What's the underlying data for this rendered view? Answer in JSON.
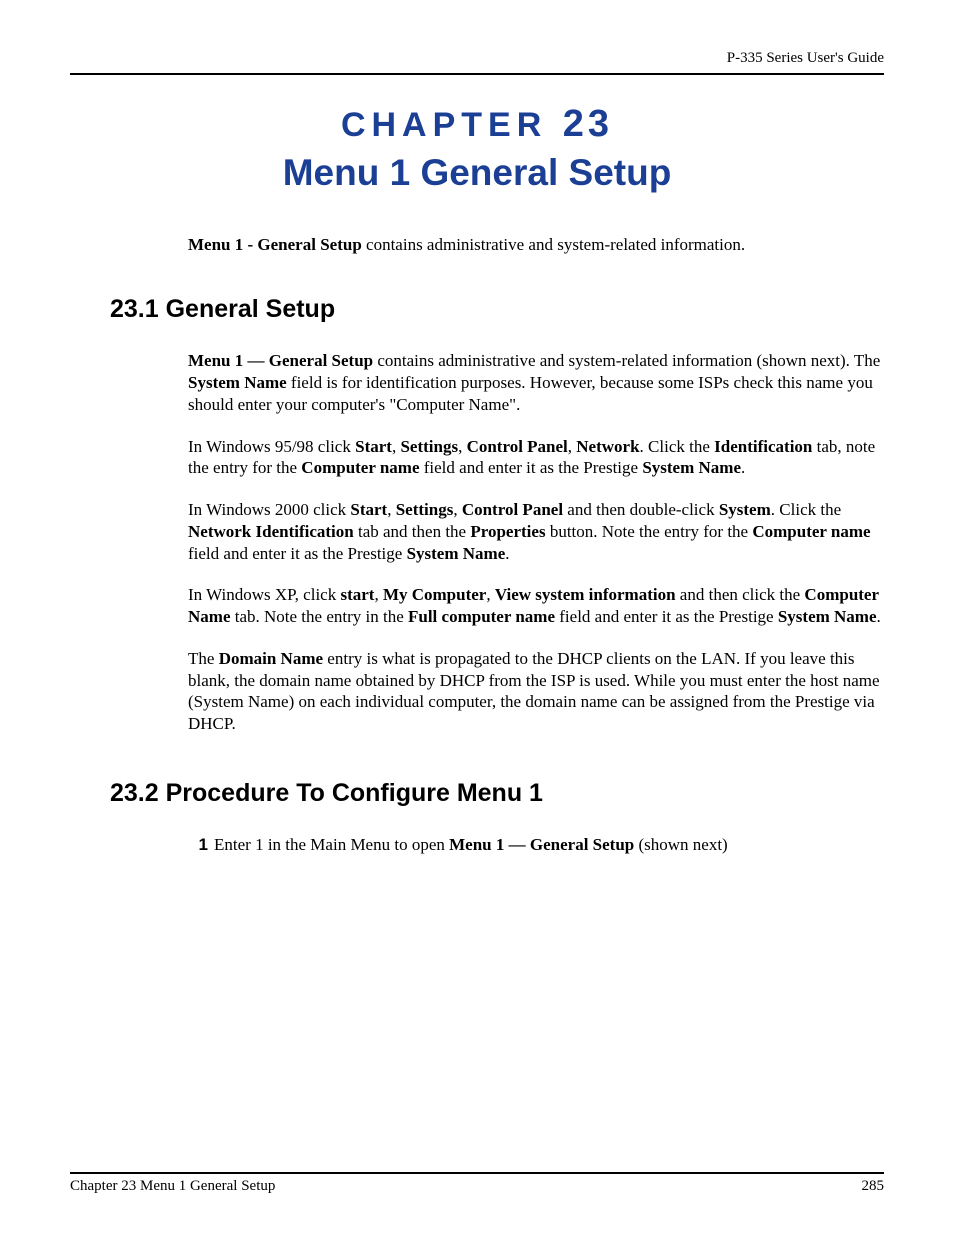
{
  "header": {
    "running": "P-335 Series User's Guide"
  },
  "chapter": {
    "label_word": "CHAPTER",
    "label_num": "23",
    "title": "Menu 1 General Setup"
  },
  "intro": {
    "bold": "Menu 1 - General Setup",
    "rest": " contains administrative and system-related information."
  },
  "section1": {
    "heading": "23.1  General Setup",
    "p1": {
      "runs": [
        {
          "b": true,
          "t": "Menu 1 — General Setup"
        },
        {
          "b": false,
          "t": " contains administrative and system-related information (shown next). The "
        },
        {
          "b": true,
          "t": "System Name"
        },
        {
          "b": false,
          "t": " field is for identification purposes. However, because some ISPs check this name you should enter your computer's  \"Computer Name\"."
        }
      ]
    },
    "p2": {
      "runs": [
        {
          "b": false,
          "t": "In Windows 95/98 click "
        },
        {
          "b": true,
          "t": "Start"
        },
        {
          "b": false,
          "t": ", "
        },
        {
          "b": true,
          "t": "Settings"
        },
        {
          "b": false,
          "t": ", "
        },
        {
          "b": true,
          "t": "Control Panel"
        },
        {
          "b": false,
          "t": ", "
        },
        {
          "b": true,
          "t": "Network"
        },
        {
          "b": false,
          "t": ". Click the "
        },
        {
          "b": true,
          "t": "Identification"
        },
        {
          "b": false,
          "t": " tab, note the entry for the "
        },
        {
          "b": true,
          "t": "Computer name"
        },
        {
          "b": false,
          "t": " field and enter it as the Prestige "
        },
        {
          "b": true,
          "t": "System Name"
        },
        {
          "b": false,
          "t": "."
        }
      ]
    },
    "p3": {
      "runs": [
        {
          "b": false,
          "t": "In Windows 2000 click "
        },
        {
          "b": true,
          "t": "Start"
        },
        {
          "b": false,
          "t": ", "
        },
        {
          "b": true,
          "t": "Settings"
        },
        {
          "b": false,
          "t": ", "
        },
        {
          "b": true,
          "t": "Control Panel"
        },
        {
          "b": false,
          "t": " and then double-click "
        },
        {
          "b": true,
          "t": "System"
        },
        {
          "b": false,
          "t": ". Click the "
        },
        {
          "b": true,
          "t": "Network Identification"
        },
        {
          "b": false,
          "t": " tab and then the "
        },
        {
          "b": true,
          "t": "Properties"
        },
        {
          "b": false,
          "t": " button. Note the entry for the "
        },
        {
          "b": true,
          "t": "Computer name"
        },
        {
          "b": false,
          "t": " field and enter it as the Prestige "
        },
        {
          "b": true,
          "t": "System Name"
        },
        {
          "b": false,
          "t": "."
        }
      ]
    },
    "p4": {
      "runs": [
        {
          "b": false,
          "t": "In Windows XP, click "
        },
        {
          "b": true,
          "t": "start"
        },
        {
          "b": false,
          "t": ", "
        },
        {
          "b": true,
          "t": "My Computer"
        },
        {
          "b": false,
          "t": ", "
        },
        {
          "b": true,
          "t": "View system information"
        },
        {
          "b": false,
          "t": " and then click the "
        },
        {
          "b": true,
          "t": "Computer Name"
        },
        {
          "b": false,
          "t": " tab. Note the entry in the "
        },
        {
          "b": true,
          "t": "Full computer name"
        },
        {
          "b": false,
          "t": " field and enter it as the Prestige "
        },
        {
          "b": true,
          "t": "System Name"
        },
        {
          "b": false,
          "t": "."
        }
      ]
    },
    "p5": {
      "runs": [
        {
          "b": false,
          "t": "The "
        },
        {
          "b": true,
          "t": "Domain Name"
        },
        {
          "b": false,
          "t": " entry is what is propagated to the DHCP clients on the LAN. If you leave this blank, the domain name obtained by DHCP from the ISP is used. While you must enter the host name (System Name) on each individual computer, the domain name can be assigned from the Prestige via DHCP."
        }
      ]
    }
  },
  "section2": {
    "heading": "23.2  Procedure To Configure Menu 1",
    "step1": {
      "num": "1",
      "runs": [
        {
          "b": false,
          "t": "Enter 1 in the Main Menu to open "
        },
        {
          "b": true,
          "t": "Menu 1 — General Setup"
        },
        {
          "b": false,
          "t": " (shown next)"
        }
      ]
    }
  },
  "footer": {
    "left": "Chapter 23 Menu 1 General Setup",
    "right": "285"
  }
}
